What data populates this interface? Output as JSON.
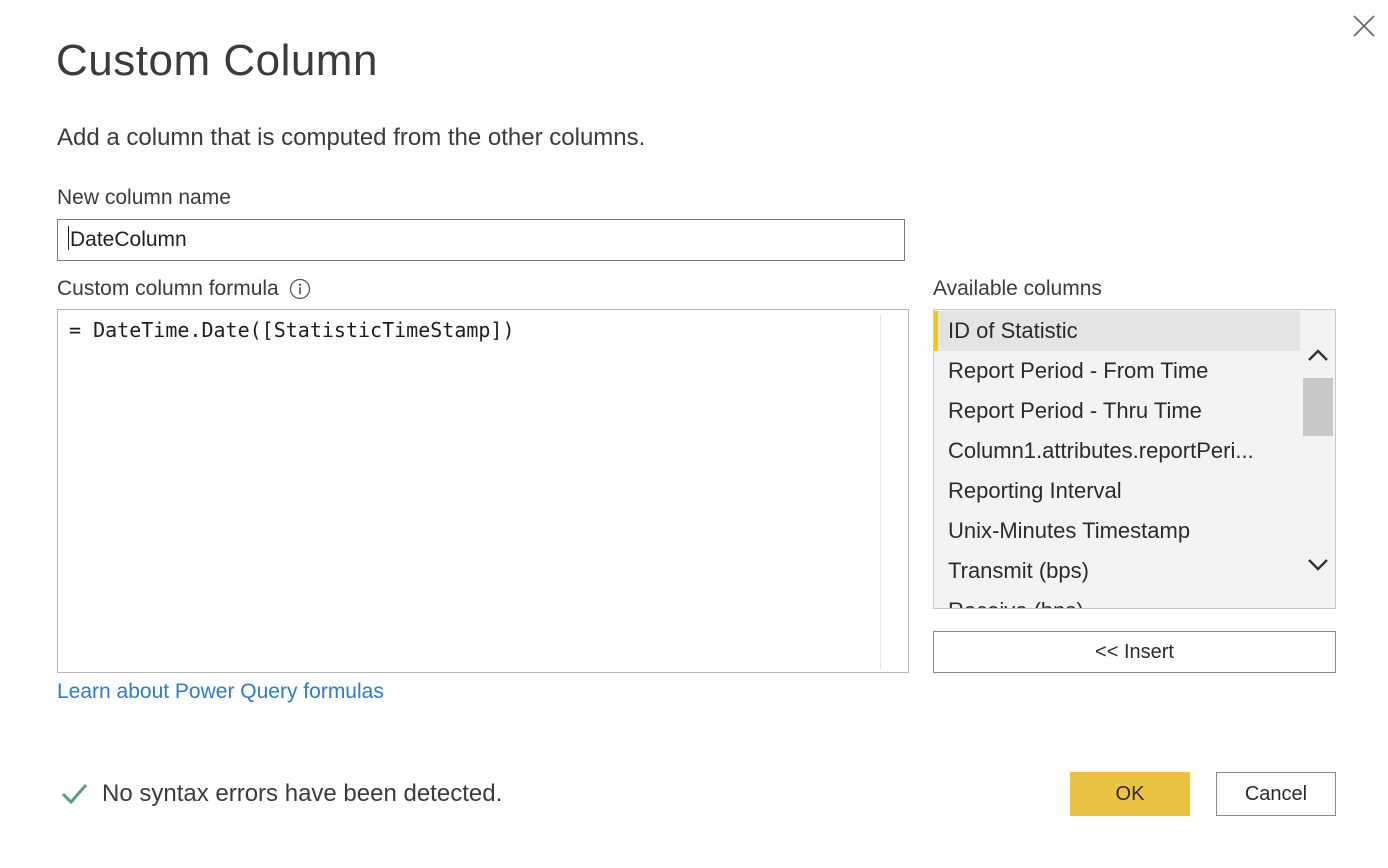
{
  "dialog": {
    "title": "Custom Column",
    "description": "Add a column that is computed from the other columns.",
    "close_icon": "close-icon"
  },
  "name_field": {
    "label": "New column name",
    "value": "DateColumn"
  },
  "formula": {
    "label": "Custom column formula",
    "info_icon": "info-icon",
    "value": "= DateTime.Date([StatisticTimeStamp])"
  },
  "available_columns": {
    "label": "Available columns",
    "items": [
      "ID of Statistic",
      "Report Period - From Time",
      "Report Period - Thru Time",
      "Column1.attributes.reportPeri...",
      "Reporting Interval",
      "Unix-Minutes Timestamp",
      "Transmit (bps)",
      "Receive (bps)"
    ],
    "selected_index": 0,
    "insert_label": "<< Insert"
  },
  "learn_link": "Learn about Power Query formulas",
  "status": {
    "icon": "checkmark-icon",
    "text": "No syntax errors have been detected."
  },
  "buttons": {
    "ok": "OK",
    "cancel": "Cancel"
  },
  "colors": {
    "accent_yellow": "#ebc342",
    "selection_bar": "#f2c811",
    "link_blue": "#2e7bc6",
    "check_green": "#5b9a86"
  }
}
